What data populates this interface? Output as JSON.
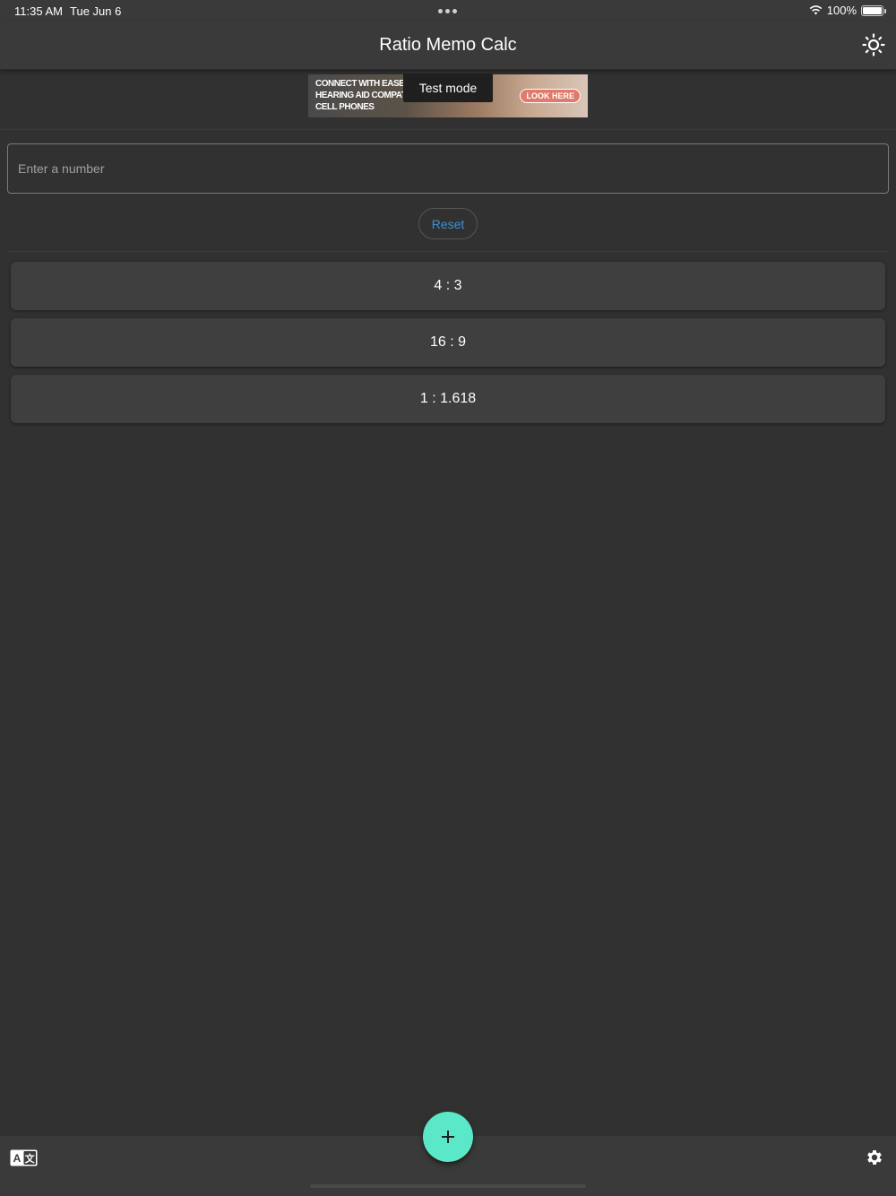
{
  "status_bar": {
    "time": "11:35 AM",
    "date": "Tue Jun 6",
    "battery": "100%",
    "battery_level": 1.0,
    "icons": [
      "multitasking-dots-icon",
      "wifi-icon",
      "battery-icon"
    ]
  },
  "header": {
    "title": "Ratio Memo Calc",
    "theme_icon": "sun-icon"
  },
  "ad": {
    "copy_lines": [
      "CONNECT WITH EASE:",
      "HEARING AID COMPATIBLE",
      "CELL PHONES"
    ],
    "cta": "LOOK HERE",
    "test_label": "Test mode"
  },
  "input": {
    "placeholder": "Enter a number",
    "value": ""
  },
  "reset": {
    "label": "Reset"
  },
  "ratios": [
    {
      "label": "4 : 3"
    },
    {
      "label": "16 : 9"
    },
    {
      "label": "1 : 1.618"
    }
  ],
  "bottom_bar": {
    "translate_icon": "translate-icon",
    "settings_icon": "gear-icon",
    "fab_icon": "plus-icon"
  },
  "colors": {
    "background": "#313131",
    "bar": "#3a3a3a",
    "card": "#3f3f3f",
    "accent_fab": "#5ae8c8",
    "link_blue": "#3b8fd8"
  }
}
